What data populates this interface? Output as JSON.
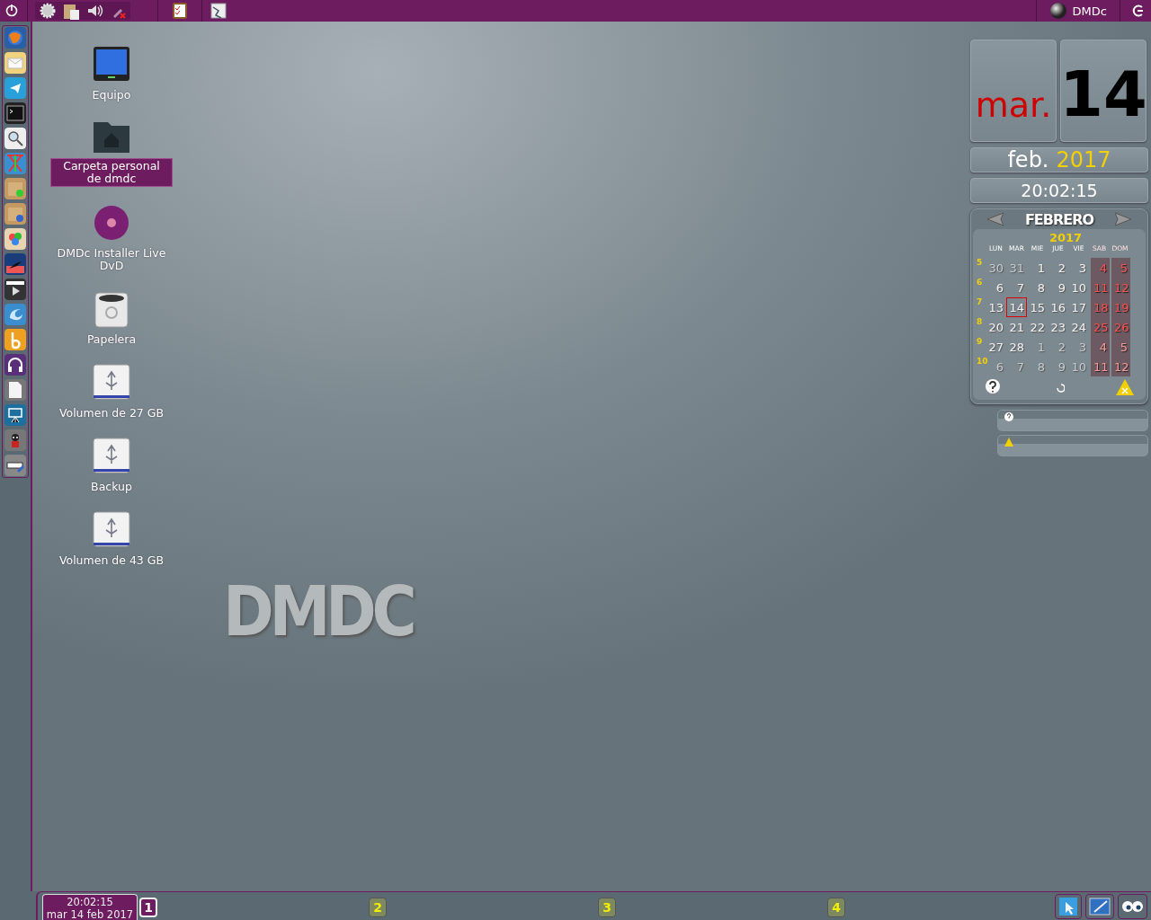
{
  "top_panel": {
    "user": "DMDc"
  },
  "desktop_icons": [
    {
      "kind": "computer",
      "label": "Equipo",
      "selected": false
    },
    {
      "kind": "home",
      "label": "Carpeta personal de dmdc",
      "selected": true
    },
    {
      "kind": "disc",
      "label": "DMDc Installer Live DvD",
      "selected": false
    },
    {
      "kind": "trash",
      "label": "Papelera",
      "selected": false
    },
    {
      "kind": "usb",
      "label": "Volumen de 27 GB",
      "selected": false
    },
    {
      "kind": "usb",
      "label": "Backup",
      "selected": false
    },
    {
      "kind": "usb",
      "label": "Volumen de 43 GB",
      "selected": false
    }
  ],
  "wallpaper": {
    "logo": "DMDC"
  },
  "date_widget": {
    "weekday": "mar.",
    "day": "14",
    "month": "feb.",
    "year": "2017",
    "time": "20:02:15"
  },
  "calendar": {
    "month": "FEBRERO",
    "year": "2017",
    "weekdays": [
      {
        "label": "LUN",
        "weekend": false
      },
      {
        "label": "MAR",
        "weekend": false
      },
      {
        "label": "MIE",
        "weekend": false
      },
      {
        "label": "JUE",
        "weekend": false
      },
      {
        "label": "VIE",
        "weekend": false
      },
      {
        "label": "SAB",
        "weekend": true
      },
      {
        "label": "DOM",
        "weekend": true
      }
    ],
    "weeks": [
      {
        "number": "5",
        "days": [
          {
            "text": "30",
            "muted": true,
            "selected": false
          },
          {
            "text": "31",
            "muted": true,
            "selected": false
          },
          {
            "text": "1",
            "muted": false,
            "selected": false
          },
          {
            "text": "2",
            "muted": false,
            "selected": false
          },
          {
            "text": "3",
            "muted": false,
            "selected": false
          },
          {
            "text": "4",
            "muted": false,
            "selected": false
          },
          {
            "text": "5",
            "muted": false,
            "selected": false
          }
        ]
      },
      {
        "number": "6",
        "days": [
          {
            "text": "6",
            "muted": false,
            "selected": false
          },
          {
            "text": "7",
            "muted": false,
            "selected": false
          },
          {
            "text": "8",
            "muted": false,
            "selected": false
          },
          {
            "text": "9",
            "muted": false,
            "selected": false
          },
          {
            "text": "10",
            "muted": false,
            "selected": false
          },
          {
            "text": "11",
            "muted": false,
            "selected": false
          },
          {
            "text": "12",
            "muted": false,
            "selected": false
          }
        ]
      },
      {
        "number": "7",
        "days": [
          {
            "text": "13",
            "muted": false,
            "selected": false
          },
          {
            "text": "14",
            "muted": false,
            "selected": true
          },
          {
            "text": "15",
            "muted": false,
            "selected": false
          },
          {
            "text": "16",
            "muted": false,
            "selected": false
          },
          {
            "text": "17",
            "muted": false,
            "selected": false
          },
          {
            "text": "18",
            "muted": false,
            "selected": false
          },
          {
            "text": "19",
            "muted": false,
            "selected": false
          }
        ]
      },
      {
        "number": "8",
        "days": [
          {
            "text": "20",
            "muted": false,
            "selected": false
          },
          {
            "text": "21",
            "muted": false,
            "selected": false
          },
          {
            "text": "22",
            "muted": false,
            "selected": false
          },
          {
            "text": "23",
            "muted": false,
            "selected": false
          },
          {
            "text": "24",
            "muted": false,
            "selected": false
          },
          {
            "text": "25",
            "muted": false,
            "selected": false
          },
          {
            "text": "26",
            "muted": false,
            "selected": false
          }
        ]
      },
      {
        "number": "9",
        "days": [
          {
            "text": "27",
            "muted": false,
            "selected": false
          },
          {
            "text": "28",
            "muted": false,
            "selected": false
          },
          {
            "text": "1",
            "muted": true,
            "selected": false
          },
          {
            "text": "2",
            "muted": true,
            "selected": false
          },
          {
            "text": "3",
            "muted": true,
            "selected": false
          },
          {
            "text": "4",
            "muted": true,
            "selected": false
          },
          {
            "text": "5",
            "muted": true,
            "selected": false
          }
        ]
      },
      {
        "number": "10",
        "days": [
          {
            "text": "6",
            "muted": true,
            "selected": false
          },
          {
            "text": "7",
            "muted": true,
            "selected": false
          },
          {
            "text": "8",
            "muted": true,
            "selected": false
          },
          {
            "text": "9",
            "muted": true,
            "selected": false
          },
          {
            "text": "10",
            "muted": true,
            "selected": false
          },
          {
            "text": "11",
            "muted": true,
            "selected": false
          },
          {
            "text": "12",
            "muted": true,
            "selected": false
          }
        ]
      }
    ]
  },
  "bottom_panel": {
    "time": "20:02:15",
    "date": "mar 14 feb 2017",
    "workspaces": [
      {
        "label": "1",
        "selected": true
      },
      {
        "label": "2",
        "selected": false
      },
      {
        "label": "3",
        "selected": false
      },
      {
        "label": "4",
        "selected": false
      }
    ]
  }
}
